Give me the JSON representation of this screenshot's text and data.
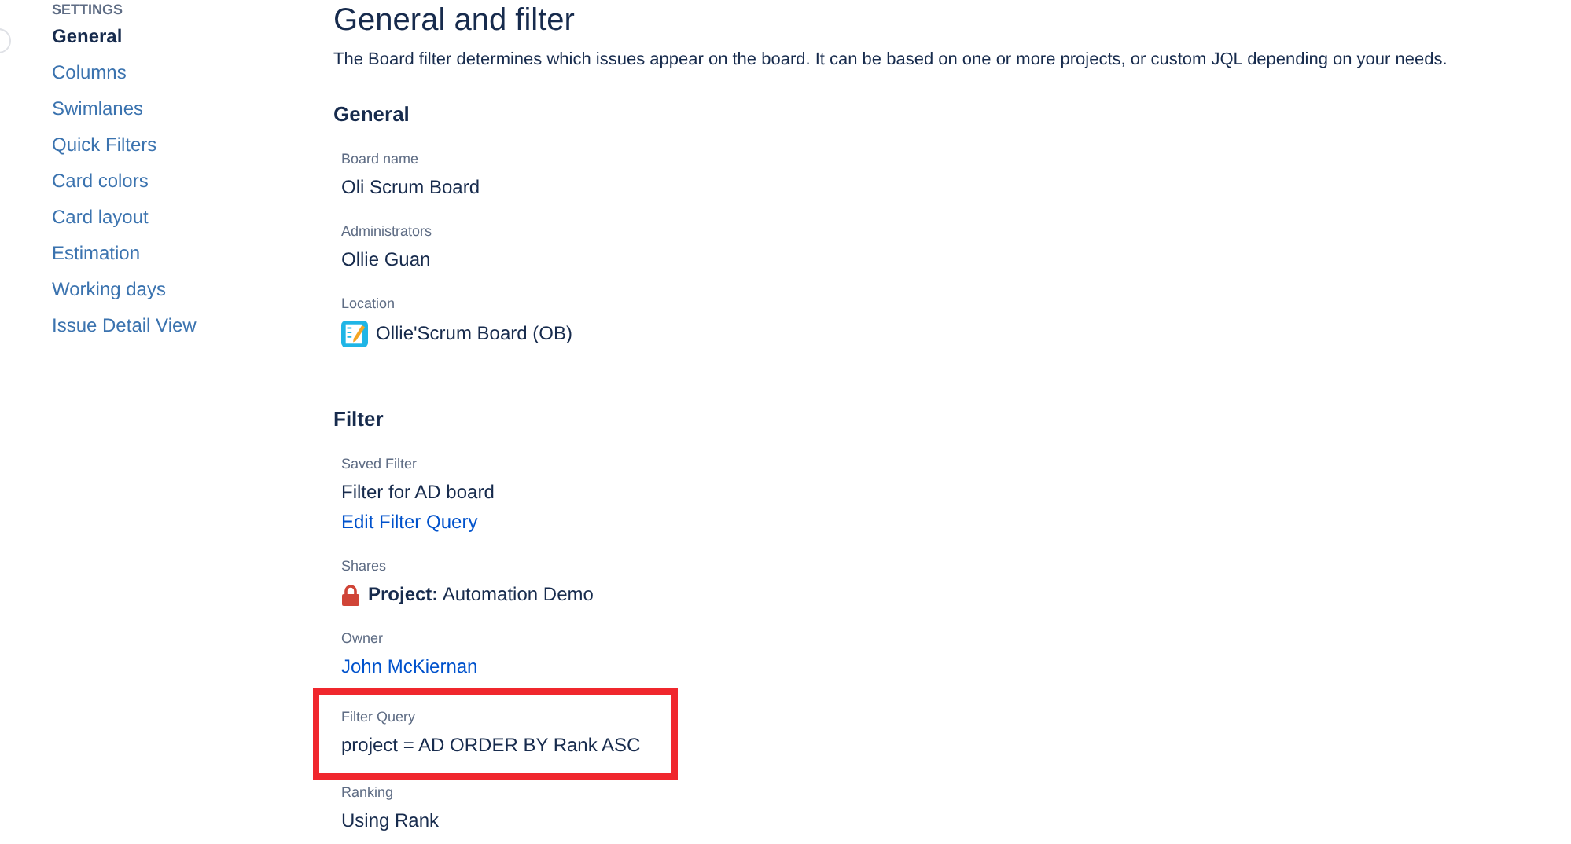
{
  "sidebar": {
    "heading": "SETTINGS",
    "items": [
      {
        "label": "General",
        "selected": true
      },
      {
        "label": "Columns",
        "selected": false
      },
      {
        "label": "Swimlanes",
        "selected": false
      },
      {
        "label": "Quick Filters",
        "selected": false
      },
      {
        "label": "Card colors",
        "selected": false
      },
      {
        "label": "Card layout",
        "selected": false
      },
      {
        "label": "Estimation",
        "selected": false
      },
      {
        "label": "Working days",
        "selected": false
      },
      {
        "label": "Issue Detail View",
        "selected": false
      }
    ]
  },
  "page": {
    "title": "General and filter",
    "description": "The Board filter determines which issues appear on the board. It can be based on one or more projects, or custom JQL depending on your needs."
  },
  "sections": [
    {
      "heading": "General",
      "fields": [
        {
          "label": "Board name",
          "highlighted": false,
          "values": [
            {
              "kind": "text",
              "text": "Oli Scrum Board"
            }
          ]
        },
        {
          "label": "Administrators",
          "highlighted": false,
          "values": [
            {
              "kind": "text",
              "text": "Ollie Guan"
            }
          ]
        },
        {
          "label": "Location",
          "highlighted": false,
          "values": [
            {
              "kind": "board",
              "text": "Ollie'Scrum Board (OB)"
            }
          ]
        }
      ]
    },
    {
      "heading": "Filter",
      "fields": [
        {
          "label": "Saved Filter",
          "highlighted": false,
          "values": [
            {
              "kind": "text",
              "text": "Filter for AD board"
            },
            {
              "kind": "link",
              "text": "Edit Filter Query"
            }
          ]
        },
        {
          "label": "Shares",
          "highlighted": false,
          "values": [
            {
              "kind": "lock",
              "text": "**Project:** Automation Demo"
            }
          ]
        },
        {
          "label": "Owner",
          "highlighted": false,
          "values": [
            {
              "kind": "link",
              "text": "John McKiernan"
            }
          ]
        },
        {
          "label": "Filter Query",
          "highlighted": true,
          "values": [
            {
              "kind": "text",
              "text": "project = AD ORDER BY Rank ASC"
            }
          ]
        },
        {
          "label": "Ranking",
          "highlighted": false,
          "values": [
            {
              "kind": "text",
              "text": "Using Rank"
            }
          ]
        }
      ]
    }
  ]
}
